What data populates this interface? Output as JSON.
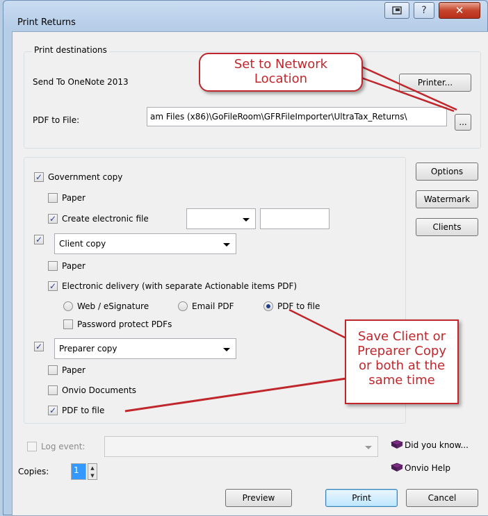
{
  "window": {
    "title": "Print Returns"
  },
  "destinations": {
    "legend": "Print destinations",
    "send_to": "Send To OneNote 2013",
    "printer_button": "Printer...",
    "pdf_label": "PDF to File:",
    "pdf_path": "am Files (x86)\\GoFileRoom\\GFRFileImporter\\UltraTax_Returns\\",
    "browse_button": "..."
  },
  "government": {
    "label": "Government copy",
    "paper": "Paper",
    "electronic": "Create electronic file",
    "checked": true,
    "paper_checked": false,
    "electronic_checked": true
  },
  "client": {
    "checked": true,
    "select_value": "Client copy",
    "paper": "Paper",
    "electronic_delivery": "Electronic delivery (with separate Actionable items PDF)",
    "radio_web": "Web / eSignature",
    "radio_email": "Email PDF",
    "radio_pdf": "PDF to file",
    "password": "Password protect PDFs"
  },
  "preparer": {
    "checked": true,
    "select_value": "Preparer copy",
    "paper": "Paper",
    "onvio_docs": "Onvio Documents",
    "pdf_to_file": "PDF to file"
  },
  "side_buttons": {
    "options": "Options",
    "watermark": "Watermark",
    "clients": "Clients"
  },
  "footer": {
    "log_event": "Log event:",
    "copies_label": "Copies:",
    "copies_value": "1",
    "did_you_know": "Did you know...",
    "onvio_help": "Onvio Help",
    "preview": "Preview",
    "print": "Print",
    "cancel": "Cancel"
  },
  "callouts": {
    "network_line1": "Set to Network",
    "network_line2": "Location",
    "save_text": "Save Client or Preparer Copy or both at the same time"
  },
  "colors": {
    "callout_red": "#c0272d",
    "window_blue": "#b6cde8",
    "dialog_bg": "#f0f0f0",
    "check_mark": "#2a3b9c"
  }
}
